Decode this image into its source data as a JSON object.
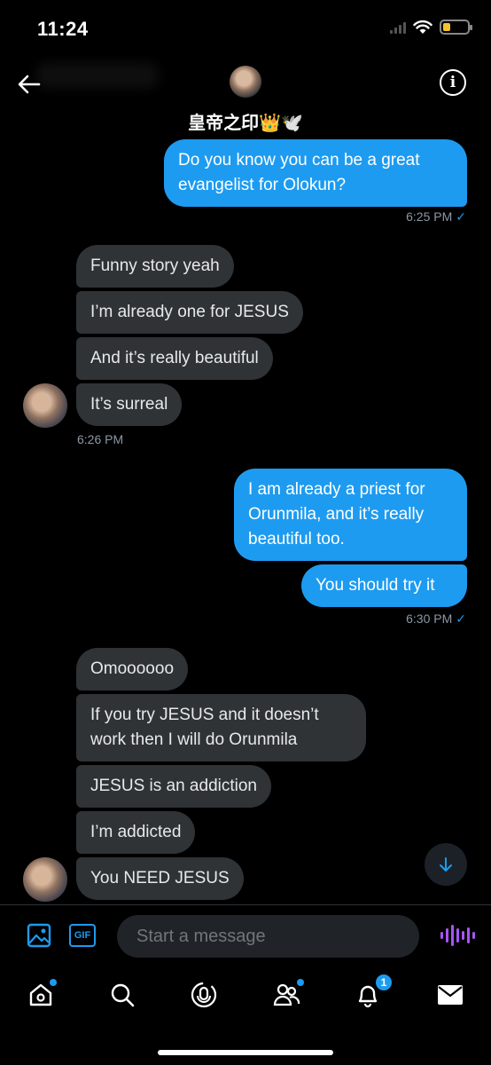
{
  "status_bar": {
    "time": "11:24"
  },
  "header": {
    "name": "皇帝之印👑🕊️"
  },
  "messages": [
    {
      "text": "Do you know you can be a great evangelist  for Olokun?"
    },
    {
      "text": "Funny story yeah"
    },
    {
      "text": "I’m already one for JESUS"
    },
    {
      "text": "And it’s really beautiful"
    },
    {
      "text": "It’s surreal"
    },
    {
      "text": "I am already a priest for Orunmila, and it’s really beautiful too."
    },
    {
      "text": "You should try it"
    },
    {
      "text": "Omoooooo"
    },
    {
      "text": "If you try JESUS and it doesn’t work then I will do Orunmila"
    },
    {
      "text": "JESUS is an addiction"
    },
    {
      "text": "I’m addicted"
    },
    {
      "text": "You NEED JESUS"
    }
  ],
  "timestamps": {
    "t1": "6:25 PM",
    "t2": "6:26 PM",
    "t3": "6:30 PM",
    "check": "✓"
  },
  "composer": {
    "placeholder": "Start a message",
    "gif_label": "GIF"
  },
  "tabs": {
    "notifications_badge": "1"
  },
  "colors": {
    "sent": "#1d9bf0",
    "received": "#2f3336",
    "voice": "#a855f7"
  }
}
